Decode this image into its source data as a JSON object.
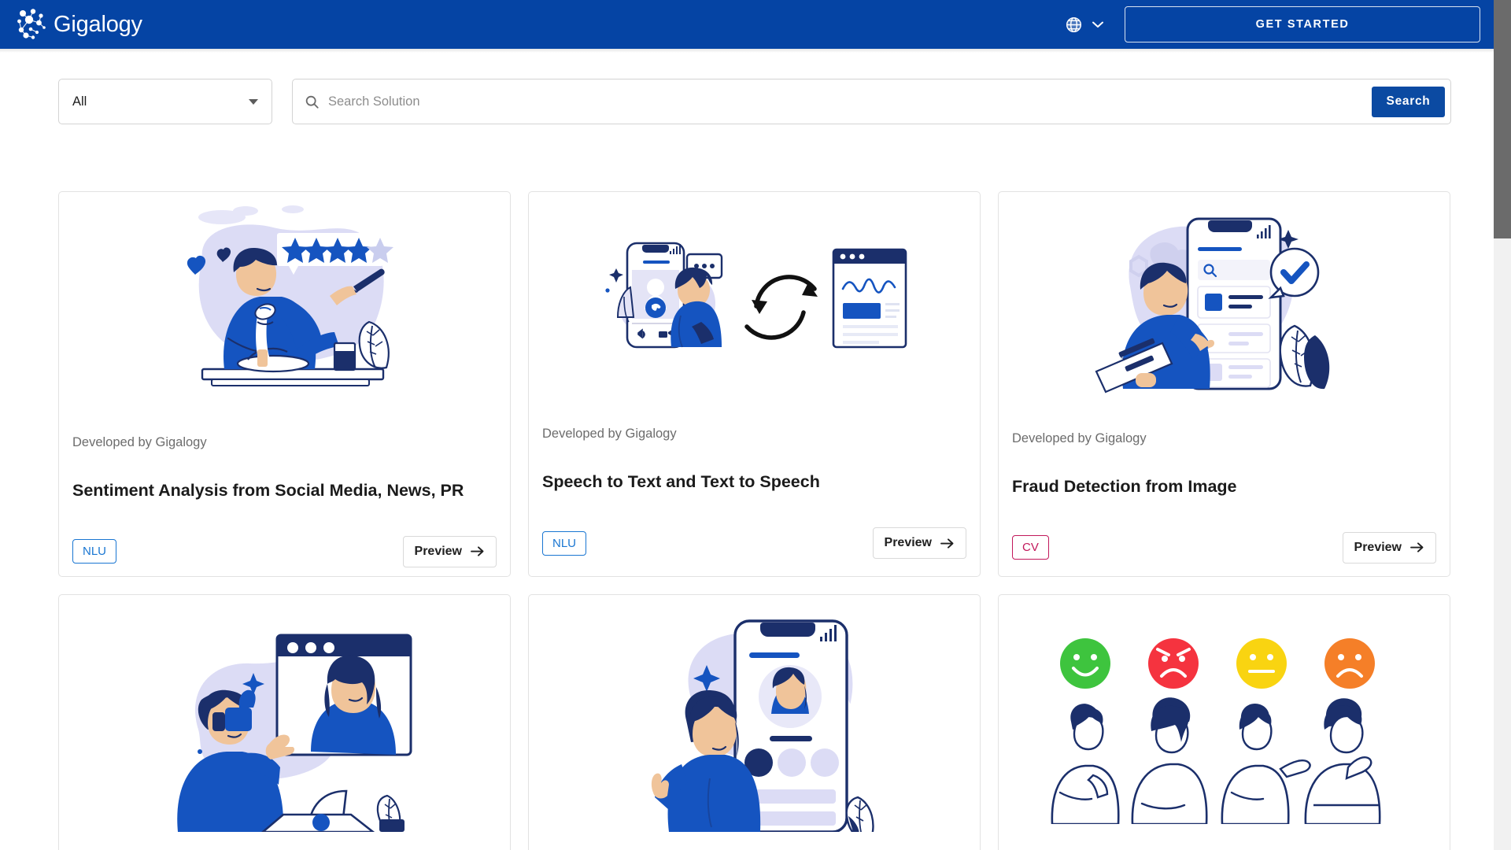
{
  "header": {
    "logo_text": "Gigalogy",
    "logo_icon": "network-nodes-icon",
    "language_icon": "globe-icon",
    "language_caret_icon": "chevron-down-icon",
    "get_started_label": "GET STARTED",
    "background_color": "#0544a4"
  },
  "search": {
    "category_value": "All",
    "category_caret_icon": "caret-down-icon",
    "search_icon": "search-icon",
    "placeholder": "Search Solution",
    "input_value": "",
    "button_label": "Search",
    "button_color": "#0b4aa2"
  },
  "cards": [
    {
      "illustration": "person-eating-with-star-rating-illustration",
      "developer": "Developed by Gigalogy",
      "title": "Sentiment Analysis from Social Media, News, PR",
      "badge": "NLU",
      "badge_color": "#1976d2",
      "preview_label": "Preview",
      "preview_icon": "arrow-right-icon"
    },
    {
      "illustration": "phone-call-to-browser-sync-illustration",
      "developer": "Developed by Gigalogy",
      "title": "Speech to Text and Text to Speech",
      "badge": "NLU",
      "badge_color": "#1976d2",
      "preview_label": "Preview",
      "preview_icon": "arrow-right-icon"
    },
    {
      "illustration": "person-with-phone-verified-check-illustration",
      "developer": "Developed by Gigalogy",
      "title": "Fraud Detection from Image",
      "badge": "CV",
      "badge_color": "#c2185b",
      "preview_label": "Preview",
      "preview_icon": "arrow-right-icon"
    },
    {
      "illustration": "video-call-thumbs-up-illustration",
      "developer": "",
      "title": "",
      "badge": "",
      "badge_color": "",
      "preview_label": "",
      "preview_icon": ""
    },
    {
      "illustration": "person-with-phone-profile-illustration",
      "developer": "",
      "title": "",
      "badge": "",
      "badge_color": "",
      "preview_label": "",
      "preview_icon": ""
    },
    {
      "illustration": "emotion-faces-feedback-illustration",
      "developer": "",
      "title": "",
      "badge": "",
      "badge_color": "",
      "preview_label": "",
      "preview_icon": ""
    }
  ],
  "emoji_faces": [
    {
      "name": "happy-face",
      "color": "#3ec43e"
    },
    {
      "name": "angry-face",
      "color": "#f5333f"
    },
    {
      "name": "neutral-face",
      "color": "#f9d411"
    },
    {
      "name": "sad-face",
      "color": "#f57f28"
    }
  ],
  "star_rating": {
    "filled": 4,
    "total": 5
  },
  "colors": {
    "brand_blue": "#0544a4",
    "illus_blue": "#1554c0",
    "illus_navy": "#1b2f6b",
    "illus_lavender": "#dcdcf5",
    "skin": "#f0c49a"
  },
  "scrollbar": {
    "name": "vertical-scrollbar"
  }
}
